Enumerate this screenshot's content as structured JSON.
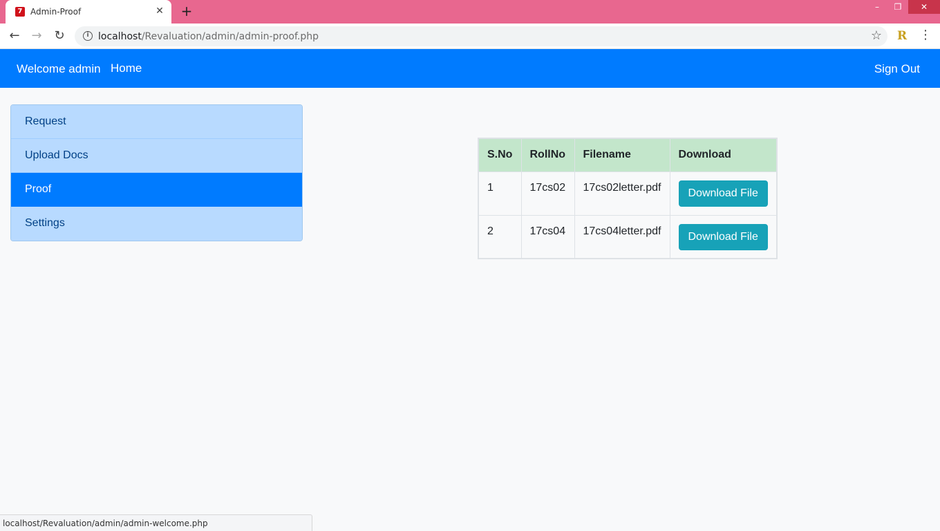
{
  "browser": {
    "tab_title": "Admin-Proof",
    "url_host": "localhost",
    "url_path": "/Revaluation/admin/admin-proof.php",
    "status_url": "localhost/Revaluation/admin/admin-welcome.php",
    "extension_letter": "R"
  },
  "navbar": {
    "brand": "Welcome admin",
    "home": "Home",
    "signout": "Sign Out"
  },
  "sidebar": {
    "items": [
      {
        "label": "Request"
      },
      {
        "label": "Upload Docs"
      },
      {
        "label": "Proof",
        "active": true
      },
      {
        "label": "Settings"
      }
    ]
  },
  "table": {
    "headers": [
      "S.No",
      "RollNo",
      "Filename",
      "Download"
    ],
    "rows": [
      {
        "sno": "1",
        "rollno": "17cs02",
        "filename": "17cs02letter.pdf",
        "button": "Download File"
      },
      {
        "sno": "2",
        "rollno": "17cs04",
        "filename": "17cs04letter.pdf",
        "button": "Download File"
      }
    ]
  },
  "colors": {
    "titlebar": "#e8678f",
    "navbar": "#007bff",
    "sidebar_item": "#b8daff",
    "sidebar_active": "#007bff",
    "table_header": "#c3e6cb",
    "download_button": "#17a2b8"
  },
  "icons": [
    "favicon-icon",
    "close-tab-icon",
    "new-tab-icon",
    "minimize-icon",
    "restore-icon",
    "close-window-icon",
    "back-icon",
    "forward-icon",
    "reload-icon",
    "info-icon",
    "star-icon",
    "extension-icon",
    "menu-icon"
  ]
}
